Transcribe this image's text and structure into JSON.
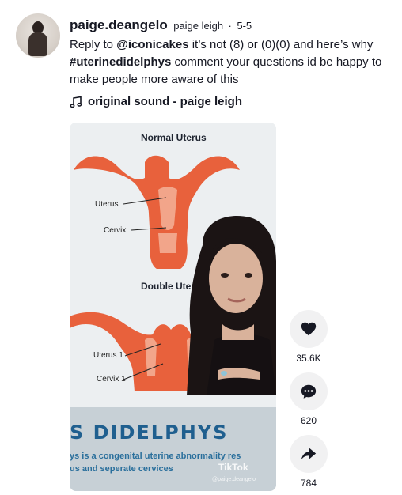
{
  "post": {
    "username": "paige.deangelo",
    "nickname": "paige leigh",
    "separator": "·",
    "date": "5-5",
    "caption_prefix": "Reply to ",
    "mention": "@iconicakes",
    "caption_mid": " it’s not (8) or (0)(0) and here’s why ",
    "hashtag": "#uterinedidelphys",
    "caption_suffix": " comment your questions id be happy to make people more aware of this",
    "music_icon": "music-note-icon",
    "sound": "original sound - paige leigh"
  },
  "video": {
    "diagram_title_1": "Normal Uterus",
    "diagram_title_2": "Double Uteru",
    "label_uterus": "Uterus",
    "label_cervix": "Cervix",
    "label_uterus_1": "Uterus 1",
    "label_cervix_1": "Cervix 1",
    "banner_title": "S DIDELPHYS",
    "banner_line_1": "ys is a congenital uterine abnormality res",
    "banner_line_2": "us and seperate cervices",
    "watermark": "TikTok",
    "watermark_handle": "@paige.deangelo"
  },
  "actions": {
    "like_icon": "heart-icon",
    "like_count": "35.6K",
    "comment_icon": "comment-icon",
    "comment_count": "620",
    "share_icon": "share-icon",
    "share_count": "784"
  },
  "colors": {
    "uterus": "#e8613c",
    "uterus_light": "#f2a58a",
    "banner_text": "#1f5f8f"
  }
}
